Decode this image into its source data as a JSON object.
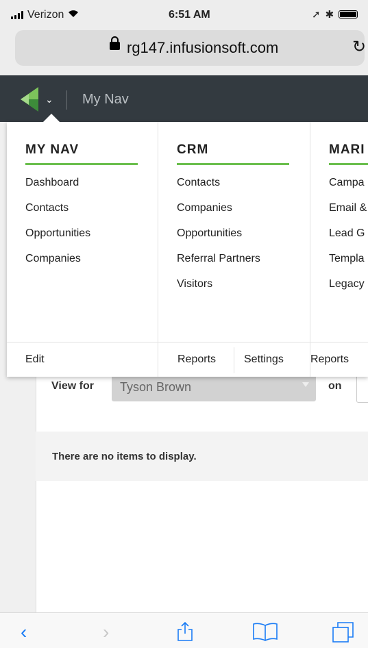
{
  "status_bar": {
    "carrier": "Verizon",
    "time": "6:51 AM"
  },
  "browser": {
    "url": "rg147.infusionsoft.com"
  },
  "app_header": {
    "nav_title": "My Nav"
  },
  "menu": {
    "columns": [
      {
        "heading": "MY NAV",
        "items": [
          "Dashboard",
          "Contacts",
          "Opportunities",
          "Companies"
        ],
        "footer": [
          "Edit"
        ]
      },
      {
        "heading": "CRM",
        "items": [
          "Contacts",
          "Companies",
          "Opportunities",
          "Referral Partners",
          "Visitors"
        ],
        "footer": [
          "Reports",
          "Settings"
        ]
      },
      {
        "heading": "MARI",
        "items": [
          "Campa",
          "Email &",
          "Lead G",
          "Templa",
          "Legacy"
        ],
        "footer": [
          "Reports"
        ]
      }
    ]
  },
  "page": {
    "view_for_label": "View for",
    "view_for_value": "Tyson Brown",
    "on_label": "on",
    "empty_message": "There are no items to display."
  },
  "colors": {
    "header_bg": "#333a40",
    "accent_green": "#6bbf4e",
    "ios_blue": "#1a7cf5"
  }
}
